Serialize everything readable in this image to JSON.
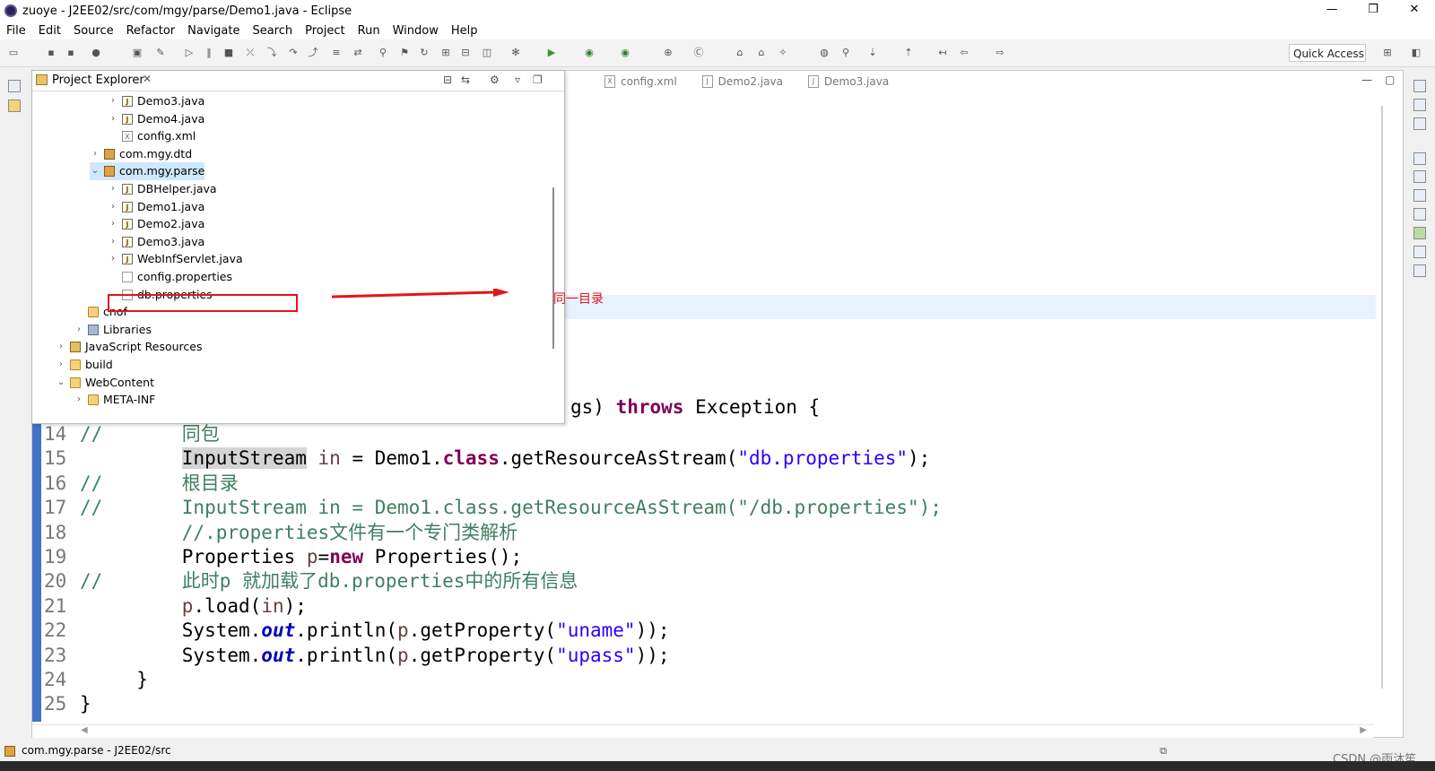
{
  "window": {
    "title": "zuoye - J2EE02/src/com/mgy/parse/Demo1.java - Eclipse",
    "controls": [
      "—",
      "❐",
      "✕"
    ]
  },
  "menu": [
    "File",
    "Edit",
    "Source",
    "Refactor",
    "Navigate",
    "Search",
    "Project",
    "Run",
    "Window",
    "Help"
  ],
  "toolbar": {
    "quick_access": "Quick Access"
  },
  "editor_tabs": [
    {
      "label": "config.xml",
      "icon": "xml-file-icon"
    },
    {
      "label": "Demo2.java",
      "icon": "java-file-icon"
    },
    {
      "label": "Demo3.java",
      "icon": "java-file-icon"
    }
  ],
  "explorer": {
    "title": "Project Explorer",
    "close_glyph": "✕",
    "tree": [
      {
        "label": "Demo3.java",
        "type": "java",
        "twisty": "›"
      },
      {
        "label": "Demo4.java",
        "type": "java",
        "twisty": "›"
      },
      {
        "label": "config.xml",
        "type": "xml",
        "twisty": ""
      },
      {
        "label": "com.mgy.dtd",
        "type": "pkg",
        "twisty": "›"
      },
      {
        "label": "com.mgy.parse",
        "type": "pkg",
        "twisty": "⌄",
        "selected": true
      },
      {
        "label": "DBHelper.java",
        "type": "java",
        "twisty": "›"
      },
      {
        "label": "Demo1.java",
        "type": "java",
        "twisty": "›"
      },
      {
        "label": "Demo2.java",
        "type": "java",
        "twisty": "›"
      },
      {
        "label": "Demo3.java",
        "type": "java",
        "twisty": "›"
      },
      {
        "label": "WebInfServlet.java",
        "type": "java",
        "twisty": "›"
      },
      {
        "label": "config.properties",
        "type": "props",
        "twisty": ""
      },
      {
        "label": "db.properties",
        "type": "props",
        "twisty": ""
      },
      {
        "label": "cnof",
        "type": "folder",
        "twisty": ""
      },
      {
        "label": "Libraries",
        "type": "lib",
        "twisty": "›"
      },
      {
        "label": "JavaScript Resources",
        "type": "js",
        "twisty": "›"
      },
      {
        "label": "build",
        "type": "folder",
        "twisty": "›"
      },
      {
        "label": "WebContent",
        "type": "folder",
        "twisty": "⌄"
      },
      {
        "label": "META-INF",
        "type": "folder",
        "twisty": "›"
      }
    ]
  },
  "annotation": {
    "text": "同一目录",
    "color": "#e4141b"
  },
  "code": {
    "partial_line": "gs) throws Exception {",
    "partial_parts": [
      "gs) ",
      "throws",
      " Exception {"
    ],
    "lines": [
      {
        "num": "14",
        "parts": [
          [
            "cm",
            "//       同包"
          ]
        ]
      },
      {
        "num": "15",
        "parts": [
          [
            "",
            "         "
          ],
          [
            "varhl",
            "InputStream"
          ],
          [
            "",
            " "
          ],
          [
            "var",
            "in"
          ],
          [
            "",
            " = Demo1."
          ],
          [
            "kw",
            "class"
          ],
          [
            "",
            ".getResourceAsStream("
          ],
          [
            "st",
            "\"db.properties\""
          ],
          [
            "",
            ");"
          ]
        ]
      },
      {
        "num": "16",
        "parts": [
          [
            "cm",
            "//       根目录"
          ]
        ]
      },
      {
        "num": "17",
        "parts": [
          [
            "cm",
            "//       InputStream in = Demo1.class.getResourceAsStream(\"/db.properties\");"
          ]
        ]
      },
      {
        "num": "18",
        "parts": [
          [
            "",
            "         "
          ],
          [
            "cm",
            "//.properties文件有一个专门类解析"
          ]
        ]
      },
      {
        "num": "19",
        "parts": [
          [
            "",
            "         Properties "
          ],
          [
            "var",
            "p"
          ],
          [
            "",
            "="
          ],
          [
            "kw",
            "new"
          ],
          [
            "",
            " Properties();"
          ]
        ]
      },
      {
        "num": "20",
        "parts": [
          [
            "cm",
            "//       此时p 就加载了db.properties中的所有信息"
          ]
        ]
      },
      {
        "num": "21",
        "parts": [
          [
            "",
            "         "
          ],
          [
            "var",
            "p"
          ],
          [
            "",
            ".load("
          ],
          [
            "var",
            "in"
          ],
          [
            "",
            ");"
          ]
        ]
      },
      {
        "num": "22",
        "parts": [
          [
            "",
            "         System."
          ],
          [
            "fld",
            "out"
          ],
          [
            "",
            ".println("
          ],
          [
            "var",
            "p"
          ],
          [
            "",
            ".getProperty("
          ],
          [
            "st",
            "\"uname\""
          ],
          [
            "",
            "));"
          ]
        ]
      },
      {
        "num": "23",
        "parts": [
          [
            "",
            "         System."
          ],
          [
            "fld",
            "out"
          ],
          [
            "",
            ".println("
          ],
          [
            "var",
            "p"
          ],
          [
            "",
            ".getProperty("
          ],
          [
            "st",
            "\"upass\""
          ],
          [
            "",
            "));"
          ]
        ]
      },
      {
        "num": "24",
        "parts": [
          [
            "",
            "     }"
          ]
        ]
      },
      {
        "num": "25",
        "parts": [
          [
            "",
            "}"
          ]
        ]
      }
    ]
  },
  "status": {
    "text": "com.mgy.parse - J2EE02/src"
  },
  "watermark": "CSDN @雨沐笙",
  "colors": {
    "comment": "#3f7f5f",
    "keyword": "#7f0055",
    "string": "#2a00ff",
    "field": "#0000c0",
    "ruler": "#3f74c6",
    "highlight": "#e8f2fe"
  }
}
